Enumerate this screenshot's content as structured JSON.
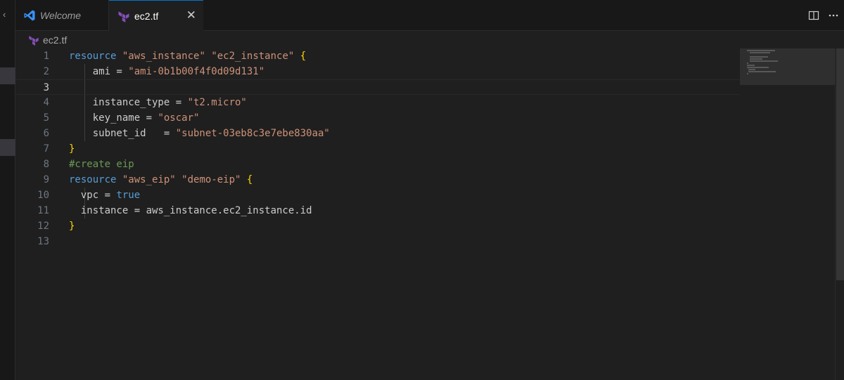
{
  "tabs": [
    {
      "label": "Welcome",
      "icon": "vscode-icon",
      "active": false
    },
    {
      "label": "ec2.tf",
      "icon": "terraform-icon",
      "active": true,
      "close": "✕"
    }
  ],
  "breadcrumb": {
    "file": "ec2.tf",
    "icon": "terraform-icon"
  },
  "editor": {
    "current_line": 3,
    "lines": [
      {
        "n": "1",
        "tokens": [
          [
            "k",
            "resource"
          ],
          [
            "p",
            " "
          ],
          [
            "s",
            "\"aws_instance\""
          ],
          [
            "p",
            " "
          ],
          [
            "s",
            "\"ec2_instance\""
          ],
          [
            "p",
            " "
          ],
          [
            "b",
            "{"
          ]
        ]
      },
      {
        "n": "2",
        "tokens": [
          [
            "p",
            "    ami = "
          ],
          [
            "s",
            "\"ami-0b1b00f4f0d09d131\""
          ]
        ]
      },
      {
        "n": "3",
        "tokens": []
      },
      {
        "n": "4",
        "tokens": [
          [
            "p",
            "    instance_type = "
          ],
          [
            "s",
            "\"t2.micro\""
          ]
        ]
      },
      {
        "n": "5",
        "tokens": [
          [
            "p",
            "    key_name = "
          ],
          [
            "s",
            "\"oscar\""
          ]
        ]
      },
      {
        "n": "6",
        "tokens": [
          [
            "p",
            "    subnet_id   = "
          ],
          [
            "s",
            "\"subnet-03eb8c3e7ebe830aa\""
          ]
        ]
      },
      {
        "n": "7",
        "tokens": [
          [
            "b",
            "}"
          ]
        ]
      },
      {
        "n": "8",
        "tokens": [
          [
            "c",
            "#create eip"
          ]
        ]
      },
      {
        "n": "9",
        "tokens": [
          [
            "k",
            "resource"
          ],
          [
            "p",
            " "
          ],
          [
            "s",
            "\"aws_eip\""
          ],
          [
            "p",
            " "
          ],
          [
            "s",
            "\"demo-eip\""
          ],
          [
            "p",
            " "
          ],
          [
            "b",
            "{"
          ]
        ]
      },
      {
        "n": "10",
        "tokens": [
          [
            "p",
            "  vpc = "
          ],
          [
            "k",
            "true"
          ]
        ]
      },
      {
        "n": "11",
        "tokens": [
          [
            "p",
            "  instance = aws_instance.ec2_instance.id"
          ]
        ]
      },
      {
        "n": "12",
        "tokens": [
          [
            "b",
            "}"
          ]
        ]
      },
      {
        "n": "13",
        "tokens": []
      }
    ]
  },
  "colors": {
    "keyword": "#569cd6",
    "string": "#ce9178",
    "comment": "#6a9955",
    "bracket": "#ffd700",
    "plain": "#cccccc",
    "accent": "#0078d4"
  },
  "toolbar": {
    "split_icon": "split-editor-icon",
    "more_icon": "more-actions-icon"
  }
}
